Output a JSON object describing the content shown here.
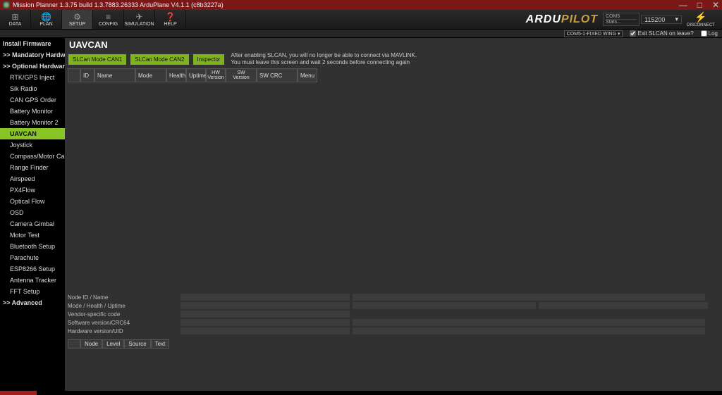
{
  "title": "Mission Planner 1.3.75 build 1.3.7883.26333 ArduPlane V4.1.1 (c8b3227a)",
  "toolbar": {
    "items": [
      {
        "label": "DATA",
        "glyph": "⊞"
      },
      {
        "label": "PLAN",
        "glyph": "🌐"
      },
      {
        "label": "SETUP",
        "glyph": "⚙"
      },
      {
        "label": "CONFIG",
        "glyph": "≡"
      },
      {
        "label": "SIMULATION",
        "glyph": "✈"
      },
      {
        "label": "HELP",
        "glyph": "❓"
      }
    ],
    "active": 2,
    "logo_prefix": "ARDU",
    "logo_suffix": "PILOT",
    "port": "COM5",
    "port_stats": "Stats...",
    "baud": "115200",
    "disconnect": "DISCONNECT"
  },
  "status": {
    "vehicle": "COM5-1-FIXED WING",
    "exit_slcan": "Exit SLCAN on leave?",
    "log": "Log"
  },
  "sidebar": [
    {
      "label": "Install Firmware",
      "bold": true
    },
    {
      "label": ">> Mandatory Hardware",
      "bold": true
    },
    {
      "label": ">> Optional Hardware",
      "bold": true
    },
    {
      "label": "RTK/GPS Inject",
      "indent": true
    },
    {
      "label": "Sik Radio",
      "indent": true
    },
    {
      "label": "CAN GPS Order",
      "indent": true
    },
    {
      "label": "Battery Monitor",
      "indent": true
    },
    {
      "label": "Battery Monitor 2",
      "indent": true
    },
    {
      "label": "UAVCAN",
      "indent": true,
      "active": true
    },
    {
      "label": "Joystick",
      "indent": true
    },
    {
      "label": "Compass/Motor Calib",
      "indent": true
    },
    {
      "label": "Range Finder",
      "indent": true
    },
    {
      "label": "Airspeed",
      "indent": true
    },
    {
      "label": "PX4Flow",
      "indent": true
    },
    {
      "label": "Optical Flow",
      "indent": true
    },
    {
      "label": "OSD",
      "indent": true
    },
    {
      "label": "Camera Gimbal",
      "indent": true
    },
    {
      "label": "Motor Test",
      "indent": true
    },
    {
      "label": "Bluetooth Setup",
      "indent": true
    },
    {
      "label": "Parachute",
      "indent": true
    },
    {
      "label": "ESP8266 Setup",
      "indent": true
    },
    {
      "label": "Antenna Tracker",
      "indent": true
    },
    {
      "label": "FFT Setup",
      "indent": true
    },
    {
      "label": ">> Advanced",
      "bold": true
    }
  ],
  "page": {
    "title": "UAVCAN",
    "buttons": [
      "SLCan Mode CAN1",
      "SLCan Mode CAN2",
      "Inspector"
    ],
    "notice_l1": "After enabling SLCAN, you will no longer be able to connect via MAVLINK.",
    "notice_l2": "You must leave this screen and wait 2 seconds before connecting again"
  },
  "table": {
    "headers": {
      "id": "ID",
      "name": "Name",
      "mode": "Mode",
      "health": "Health",
      "uptime": "Uptime",
      "hw1": "HW",
      "hw2": "Version",
      "sw1": "SW",
      "sw2": "Version",
      "swcrc": "SW CRC",
      "menu": "Menu"
    }
  },
  "info": {
    "r1": "Node ID / Name",
    "r2": "Mode / Health / Uptime",
    "r3": "Vendor-specific code",
    "r4": "Software version/CRC64",
    "r5": "Hardware version/UID"
  },
  "log": {
    "node": "Node",
    "level": "Level",
    "source": "Source",
    "text": "Text"
  }
}
